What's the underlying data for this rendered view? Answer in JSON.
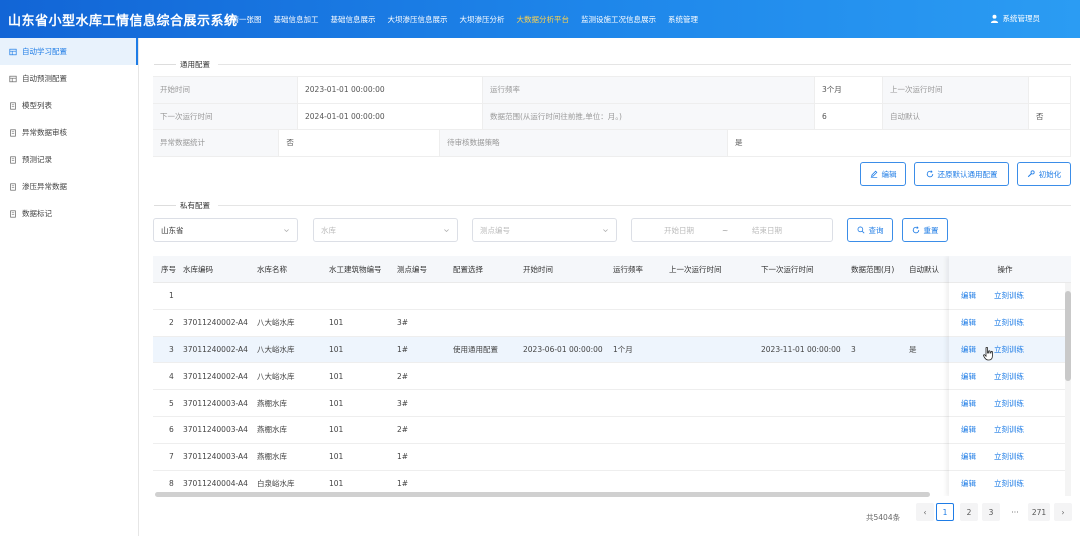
{
  "header": {
    "title": "山东省小型水库工情信息综合展示系统",
    "nav": [
      "工情一张图",
      "基础信息加工",
      "基础信息展示",
      "大坝渗压信息展示",
      "大坝渗压分析",
      "大数据分析平台",
      "监测设施工况信息展示",
      "系统管理"
    ],
    "active_nav": "大数据分析平台",
    "user": "系统管理员"
  },
  "sidebar": {
    "items": [
      {
        "label": "自动学习配置",
        "icon": "grid-icon"
      },
      {
        "label": "自动预测配置",
        "icon": "grid-icon"
      },
      {
        "label": "模型列表",
        "icon": "doc-icon"
      },
      {
        "label": "异常数据审核",
        "icon": "doc-icon"
      },
      {
        "label": "预测记录",
        "icon": "doc-icon"
      },
      {
        "label": "渗压异常数据",
        "icon": "doc-icon"
      },
      {
        "label": "数据标记",
        "icon": "doc-icon"
      }
    ],
    "active_index": 0
  },
  "common": {
    "title": "通用配置",
    "rows": [
      [
        {
          "label": "开始时间",
          "value": "2023-01-01 00:00:00"
        },
        {
          "label": "运行频率",
          "value": "3个月"
        },
        {
          "label": "上一次运行时间",
          "value": ""
        }
      ],
      [
        {
          "label": "下一次运行时间",
          "value": "2024-01-01 00:00:00"
        },
        {
          "label": "数据范围(从运行时间往前推,单位：月。)",
          "value": "6"
        },
        {
          "label": "自动默认",
          "value": "否"
        }
      ],
      [
        {
          "label": "异常数据统计",
          "value": "否"
        },
        {
          "label": "待审核数据策略",
          "value": "是"
        }
      ]
    ],
    "buttons": {
      "edit": "编辑",
      "restore": "还原默认通用配置",
      "init": "初始化"
    }
  },
  "private": {
    "title": "私有配置",
    "filters": {
      "province": "山东省",
      "reservoir_placeholder": "水库",
      "point_placeholder": "测点编号",
      "start_placeholder": "开始日期",
      "range_sep": "~",
      "end_placeholder": "结束日期",
      "query": "查询",
      "reset": "重置"
    }
  },
  "table": {
    "columns": [
      "序号",
      "水库编码",
      "水库名称",
      "水工建筑物编号",
      "测点编号",
      "配置选择",
      "开始时间",
      "运行频率",
      "上一次运行时间",
      "下一次运行时间",
      "数据范围(月)",
      "自动默认"
    ],
    "op_header": "操作",
    "op_edit": "编辑",
    "op_train": "立刻训练",
    "rows": [
      [
        "1",
        "",
        "",
        "",
        "",
        "",
        "",
        "",
        "",
        "",
        "",
        ""
      ],
      [
        "2",
        "37011240002-A4",
        "八大峪水库",
        "101",
        "3#",
        "",
        "",
        "",
        "",
        "",
        "",
        ""
      ],
      [
        "3",
        "37011240002-A4",
        "八大峪水库",
        "101",
        "1#",
        "使用通用配置",
        "2023-06-01 00:00:00",
        "1个月",
        "",
        "2023-11-01 00:00:00",
        "3",
        "是"
      ],
      [
        "4",
        "37011240002-A4",
        "八大峪水库",
        "101",
        "2#",
        "",
        "",
        "",
        "",
        "",
        "",
        ""
      ],
      [
        "5",
        "37011240003-A4",
        "燕棚水库",
        "101",
        "3#",
        "",
        "",
        "",
        "",
        "",
        "",
        ""
      ],
      [
        "6",
        "37011240003-A4",
        "燕棚水库",
        "101",
        "2#",
        "",
        "",
        "",
        "",
        "",
        "",
        ""
      ],
      [
        "7",
        "37011240003-A4",
        "燕棚水库",
        "101",
        "1#",
        "",
        "",
        "",
        "",
        "",
        "",
        ""
      ],
      [
        "8",
        "37011240004-A4",
        "白泉峪水库",
        "101",
        "1#",
        "",
        "",
        "",
        "",
        "",
        "",
        ""
      ]
    ],
    "highlight_index": 2
  },
  "pagination": {
    "total": "共5404条",
    "pages": [
      "1",
      "2",
      "3",
      "···",
      "271"
    ],
    "current": "1",
    "prev": "‹",
    "next": "›"
  }
}
